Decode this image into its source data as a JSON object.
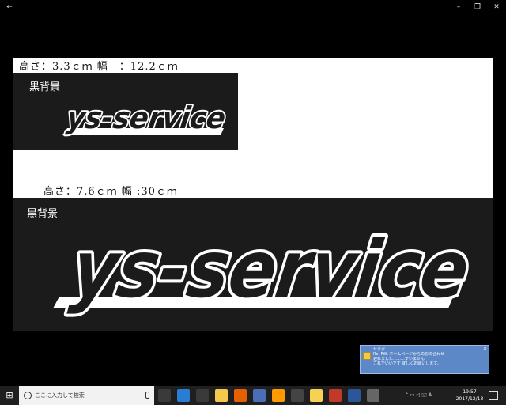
{
  "window": {
    "back_glyph": "←",
    "minimize_glyph": "–",
    "maximize_glyph": "❐",
    "close_glyph": "✕"
  },
  "photo": {
    "small": {
      "dimensions": "高さ：3.3ｃｍ 幅　：12.2ｃｍ",
      "label": "黒背景",
      "logo_text": "ys-service"
    },
    "large": {
      "dimensions": "高さ：7.6ｃｍ 幅 :30ｃｍ",
      "label": "黒背景",
      "logo_text": "ys-service"
    }
  },
  "notification": {
    "line1": "サクボ",
    "line2": "Re: FW: ホームページからのお問合わせ",
    "line3": "遅れました………すいません",
    "line4": "これでいいです 宜しくお願いします。"
  },
  "taskbar": {
    "start_glyph": "⊞",
    "search_placeholder": "ここに入力して検索",
    "time": "19:57",
    "date": "2017/12/13",
    "tray_glyphs": "⌃ ▭ ◁ 🖂 A",
    "apps": [
      {
        "name": "task-view",
        "color": "#3a3a3a"
      },
      {
        "name": "edge",
        "color": "#2b7cd3"
      },
      {
        "name": "store",
        "color": "#3a3a3a"
      },
      {
        "name": "explorer",
        "color": "#f2c94c"
      },
      {
        "name": "firefox",
        "color": "#e66000"
      },
      {
        "name": "app-blue",
        "color": "#4a6fb5"
      },
      {
        "name": "illustrator",
        "color": "#ff9a00"
      },
      {
        "name": "mail",
        "color": "#444444"
      },
      {
        "name": "sticky",
        "color": "#f7d154"
      },
      {
        "name": "red-app",
        "color": "#c0392b"
      },
      {
        "name": "word",
        "color": "#2b579a"
      },
      {
        "name": "photos",
        "color": "#666666"
      }
    ]
  }
}
